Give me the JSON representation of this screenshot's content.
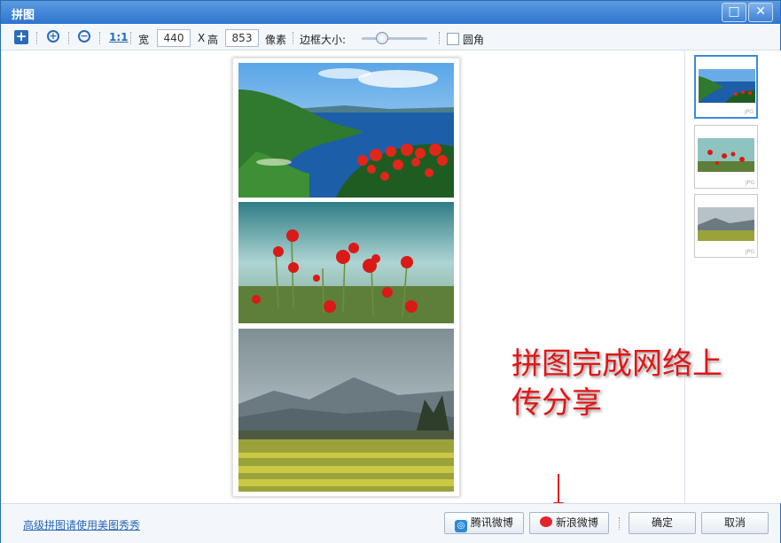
{
  "window": {
    "title": "拼图"
  },
  "titlebar": {
    "maximize_icon": "maximize-icon",
    "close_icon": "close-icon"
  },
  "toolbar": {
    "add_icon": "add-image-icon",
    "zoom_in_icon": "zoom-in-icon",
    "zoom_out_icon": "zoom-out-icon",
    "actual_size_label": "1:1",
    "width_label": "宽",
    "width_value": "440",
    "x_label": "X",
    "height_label": "高",
    "height_value": "853",
    "unit_label": "像素",
    "border_label": "边框大小:",
    "round_corner_label": "圆角",
    "round_corner_checked": false
  },
  "thumbnails": [
    {
      "name": "coastal-landscape",
      "label": "JPG",
      "selected": true
    },
    {
      "name": "red-poppies",
      "label": "JPG",
      "selected": false
    },
    {
      "name": "misty-mountains-field",
      "label": "JPG",
      "selected": false
    }
  ],
  "annotation": {
    "line1": "拼图完成网络上",
    "line2": "传分享"
  },
  "bottom": {
    "advanced_link": "高级拼图请使用美图秀秀",
    "tencent_weibo": "腾讯微博",
    "sina_weibo": "新浪微博",
    "confirm": "确定",
    "cancel": "取消"
  },
  "colors": {
    "accent": "#2f75cf",
    "annotation": "#e01717"
  }
}
